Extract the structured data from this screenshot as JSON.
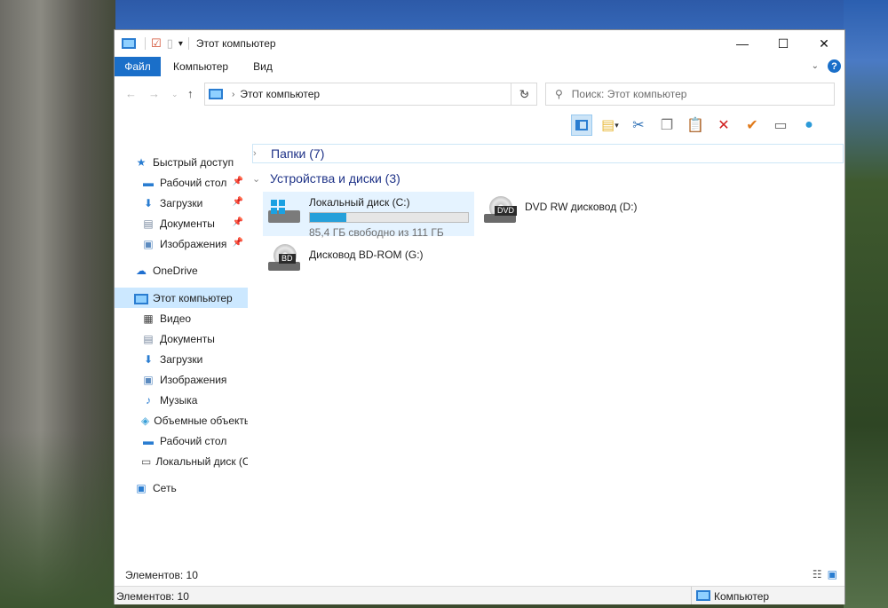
{
  "window": {
    "title": "Этот компьютер",
    "controls": {
      "minimize": "—",
      "maximize": "☐",
      "close": "✕"
    }
  },
  "ribbon": {
    "tabs": [
      {
        "label": "Файл"
      },
      {
        "label": "Компьютер"
      },
      {
        "label": "Вид"
      }
    ],
    "help": "?"
  },
  "address": {
    "path": "Этот компьютер",
    "search_placeholder": "Поиск: Этот компьютер"
  },
  "toolbar": {
    "icons": [
      "pane-icon",
      "new-folder-icon",
      "cut-icon",
      "copy-icon",
      "paste-icon",
      "delete-icon",
      "check-icon",
      "rename-icon",
      "globe-icon"
    ]
  },
  "sidebar": {
    "items": [
      {
        "label": "Быстрый доступ",
        "icon": "star-icon"
      },
      {
        "label": "Рабочий стол",
        "icon": "desktop-icon",
        "pinned": true
      },
      {
        "label": "Загрузки",
        "icon": "download-icon",
        "pinned": true
      },
      {
        "label": "Документы",
        "icon": "document-icon",
        "pinned": true
      },
      {
        "label": "Изображения",
        "icon": "pictures-icon",
        "pinned": true
      },
      {
        "label": "OneDrive",
        "icon": "cloud-icon"
      },
      {
        "label": "Этот компьютер",
        "icon": "computer-icon",
        "selected": true
      },
      {
        "label": "Видео",
        "icon": "video-icon"
      },
      {
        "label": "Документы",
        "icon": "document-icon"
      },
      {
        "label": "Загрузки",
        "icon": "download-icon"
      },
      {
        "label": "Изображения",
        "icon": "pictures-icon"
      },
      {
        "label": "Музыка",
        "icon": "music-icon"
      },
      {
        "label": "Объемные объекты",
        "icon": "3d-objects-icon"
      },
      {
        "label": "Рабочий стол",
        "icon": "desktop-icon"
      },
      {
        "label": "Локальный диск (C:)",
        "icon": "drive-icon"
      },
      {
        "label": "Сеть",
        "icon": "network-icon"
      }
    ]
  },
  "content": {
    "groups": [
      {
        "label": "Папки (7)",
        "expanded": false
      },
      {
        "label": "Устройства и диски (3)",
        "expanded": true
      }
    ],
    "drives": [
      {
        "name": "Локальный диск (C:)",
        "free_text": "85,4 ГБ свободно из 111 ГБ",
        "used_fraction": 0.23,
        "icon": "windows-drive-icon"
      },
      {
        "name": "DVD RW дисковод (D:)",
        "badge": "DVD",
        "icon": "dvd-drive-icon"
      },
      {
        "name": "Дисковод BD-ROM (G:)",
        "badge": "BD",
        "icon": "bd-drive-icon"
      }
    ]
  },
  "status": {
    "items_count_top": "Элементов: 10",
    "items_count_bottom": "Элементов: 10",
    "computer_label": "Компьютер"
  },
  "colors": {
    "accent": "#1a6fc9",
    "selection": "#cce8ff",
    "progress": "#26a0da"
  }
}
